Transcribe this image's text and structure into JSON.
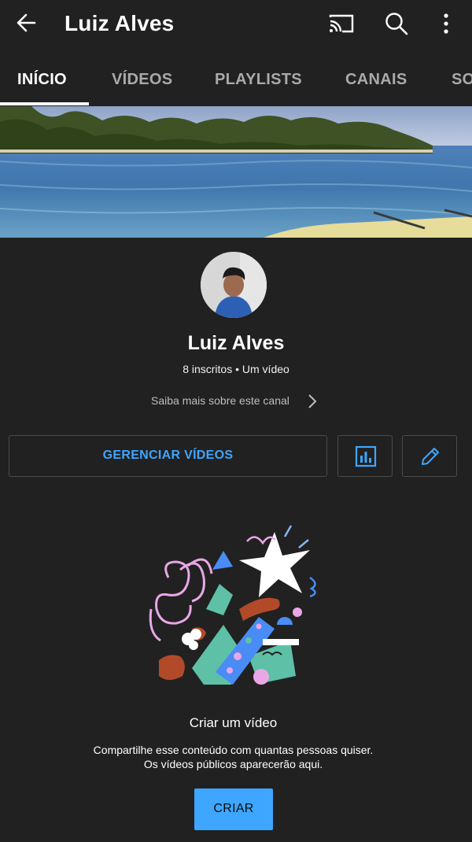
{
  "header": {
    "title": "Luiz Alves",
    "back_icon": "arrow-left-icon",
    "cast_icon": "cast-icon",
    "search_icon": "search-icon",
    "more_icon": "more-vert-icon"
  },
  "tabs": [
    {
      "label": "INÍCIO",
      "active": true
    },
    {
      "label": "VÍDEOS",
      "active": false
    },
    {
      "label": "PLAYLISTS",
      "active": false
    },
    {
      "label": "CANAIS",
      "active": false
    },
    {
      "label": "SOBRE",
      "active": false
    }
  ],
  "channel": {
    "name": "Luiz Alves",
    "meta": "8 inscritos • Um vídeo",
    "about_link": "Saiba mais sobre este canal"
  },
  "actions": {
    "manage_videos": "GERENCIAR VÍDEOS",
    "stats_icon": "bar-chart-icon",
    "edit_icon": "pencil-icon"
  },
  "empty_state": {
    "title": "Criar um vídeo",
    "description_line1": "Compartilhe esse conteúdo com quantas pessoas quiser.",
    "description_line2": "Os vídeos públicos aparecerão aqui.",
    "create_button": "CRIAR"
  },
  "colors": {
    "background": "#212121",
    "accent_blue": "#3ea6ff",
    "tab_inactive": "#aaaaaa"
  }
}
